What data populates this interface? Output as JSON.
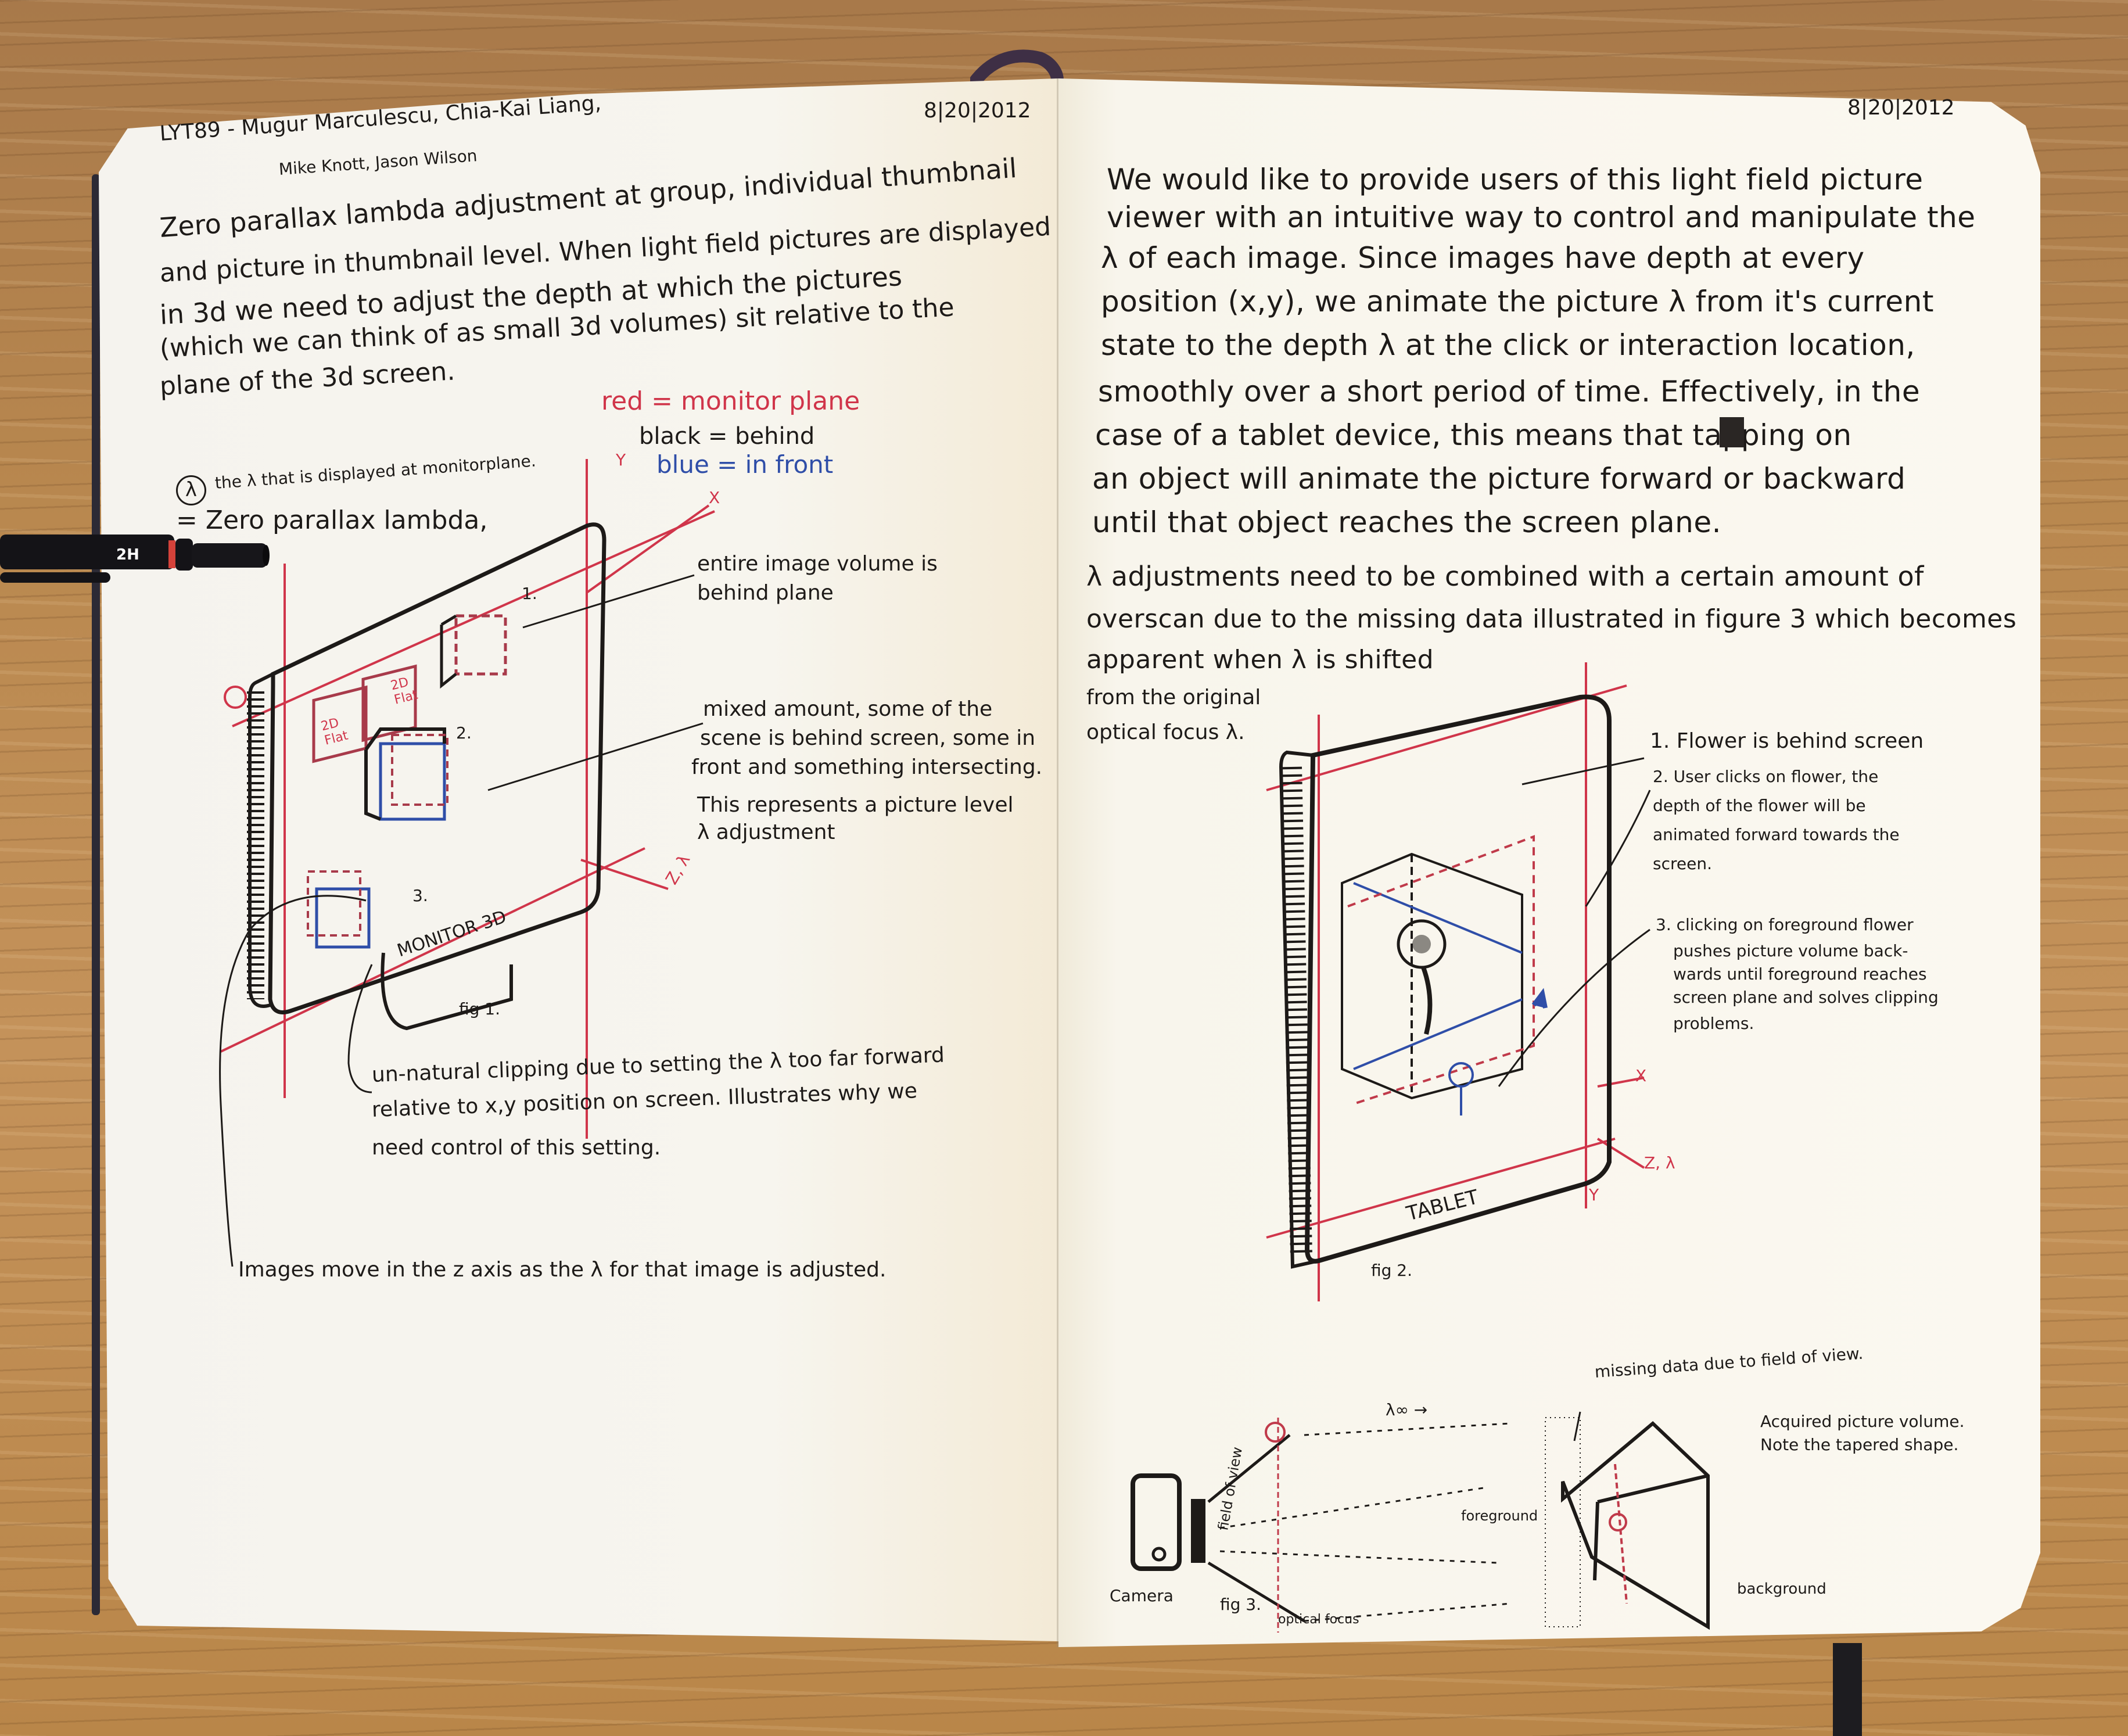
{
  "notebook": {
    "pen": {
      "label": "2H"
    },
    "left_page": {
      "header": {
        "authors_line1": "LYT89 - Mugur Marculescu, Chia-Kai Liang,",
        "authors_line2": "Mike Knott, Jason Wilson",
        "date": "8|20|2012"
      },
      "intro": [
        "Zero parallax lambda adjustment at group, individual thumbnail",
        "and picture in thumbnail level. When light field pictures are displayed",
        "in 3d we need to adjust the depth at which the pictures",
        "(which we can think of as small 3d volumes) sit relative to the",
        "plane of the 3d screen."
      ],
      "definition": {
        "symbol": "λ",
        "title": "= Zero parallax lambda,",
        "subtitle": "the λ that is displayed at monitorplane."
      },
      "legend": {
        "red": "red = monitor plane",
        "black": "black = behind",
        "blue": "blue = in front"
      },
      "fig1": {
        "caption": "fig 1.",
        "monitor_label": "MONITOR 3D",
        "flat_label_1": "2D Flat",
        "flat_label_2": "2D Flat",
        "marker_1": "1.",
        "marker_2": "2.",
        "marker_3": "3.",
        "axis_y": "Y",
        "axis_x": "X",
        "axis_z": "Z, λ",
        "colors": {
          "red": "#d0354a",
          "black": "#1d1a18",
          "blue": "#2f4ea8"
        }
      },
      "annotations": {
        "note1": [
          "entire image volume is",
          "behind plane"
        ],
        "note2": [
          "mixed amount, some of the",
          "scene is behind screen, some in",
          "front and something intersecting.",
          "This represents a picture level",
          "λ adjustment"
        ],
        "note3": [
          "un-natural clipping due to setting the λ too far forward",
          "relative to x,y position on screen. Illustrates why we",
          "need control of this setting."
        ],
        "note4": "Images move in the z axis as the λ for that image is adjusted."
      }
    },
    "right_page": {
      "date": "8|20|2012",
      "paragraph1": [
        "We would like to provide users of this light field picture",
        "viewer with an intuitive way to control and manipulate the",
        "λ of each image. Since images have depth at every",
        "position (x,y), we animate the picture λ from it's current",
        "state to the depth λ at the click or interaction location,",
        "smoothly over a short period of time. Effectively, in the",
        "case of a tablet device, this means that tapping on",
        "an object will animate the picture forward or backward",
        "until that object reaches the screen plane."
      ],
      "paragraph2": [
        "λ adjustments need to be combined with a certain amount of",
        "overscan due to the missing data illustrated in figure 3 which becomes",
        "apparent when λ is shifted",
        "from the original",
        "optical focus λ."
      ],
      "fig2": {
        "caption": "fig 2.",
        "device_label": "TABLET",
        "axis_x": "X",
        "axis_y": "Y",
        "axis_z": "Z, λ",
        "steps": [
          [
            "1. Flower is behind screen"
          ],
          [
            "2. User clicks on flower, the",
            "depth of the flower will be",
            "animated forward towards the",
            "screen."
          ],
          [
            "3. clicking on foreground flower",
            "pushes picture volume back-",
            "wards until foreground reaches",
            "screen plane and solves clipping",
            "problems."
          ]
        ]
      },
      "fig3": {
        "caption": "fig 3.",
        "camera_label": "Camera",
        "fov_label": "field of view",
        "optical_focus_label": "optical focus",
        "infinity_label": "λ∞ →",
        "missing_data_label": "missing data due to field of view.",
        "volume_note": [
          "Acquired picture volume.",
          "Note the tapered shape."
        ],
        "foreground_label": "foreground",
        "background_label": "background"
      }
    }
  }
}
